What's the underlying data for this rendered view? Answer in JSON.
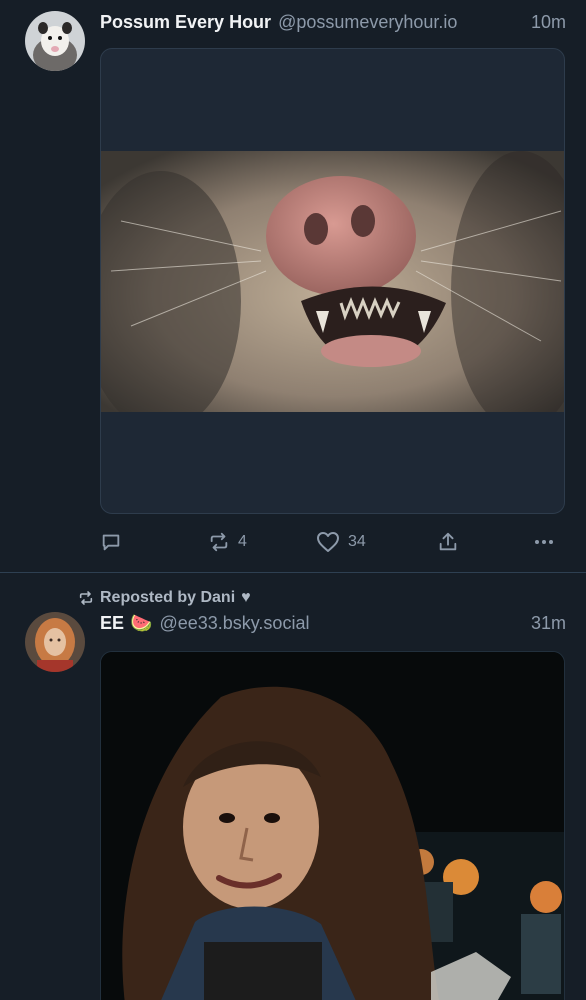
{
  "posts": [
    {
      "author": {
        "display_name": "Possum Every Hour",
        "handle": "@possumeveryhour.io",
        "avatar": "possum-avatar"
      },
      "timestamp": "10m",
      "media": {
        "type": "image",
        "subject": "possum-closeup-photo"
      },
      "actions": {
        "reply": {
          "icon": "reply-icon",
          "count": ""
        },
        "repost": {
          "icon": "repost-icon",
          "count": "4"
        },
        "like": {
          "icon": "heart-icon",
          "count": "34"
        },
        "share": {
          "icon": "share-icon"
        },
        "more": {
          "icon": "more-icon"
        }
      }
    },
    {
      "repost_label": "Reposted by Dani",
      "repost_heart": "♥",
      "author": {
        "display_name": "EE",
        "emoji": "🍉",
        "handle": "@ee33.bsky.social",
        "avatar": "ee-avatar"
      },
      "timestamp": "31m",
      "media": {
        "type": "video",
        "subject": "long-haired-man-video-frame"
      }
    }
  ],
  "colors": {
    "background": "#161e27",
    "primary_text": "#f1f3f5",
    "secondary_text": "#8d9aaa",
    "divider": "#2e4052",
    "card_background": "#1e2835"
  }
}
